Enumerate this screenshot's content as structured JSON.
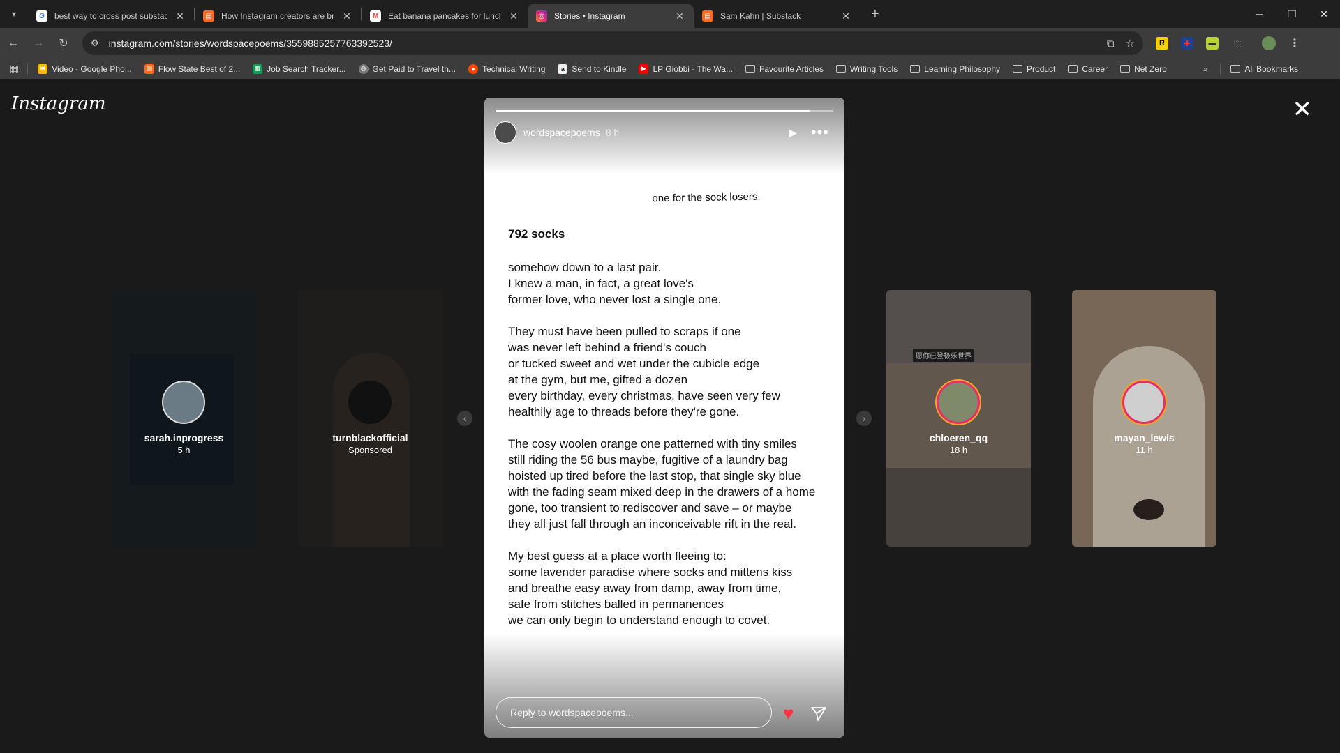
{
  "browser": {
    "tabs": [
      {
        "title": "best way to cross post substack",
        "icon": "google-icon",
        "color": "#4285f4",
        "active": false
      },
      {
        "title": "How Instagram creators are bri",
        "icon": "substack-icon",
        "color": "#ff6719",
        "active": false
      },
      {
        "title": "Eat banana pancakes for lunch",
        "icon": "gmail-icon",
        "color": "#ea4335",
        "active": false
      },
      {
        "title": "Stories • Instagram",
        "icon": "instagram-icon",
        "color": "#e1306c",
        "active": true
      },
      {
        "title": "Sam Kahn | Substack",
        "icon": "substack-icon",
        "color": "#ff6719",
        "active": false
      }
    ],
    "url": "instagram.com/stories/wordspacepoems/3559885257763392523/",
    "bookmarks": [
      {
        "label": "Video - Google Pho...",
        "type": "site",
        "color": "#fbbc04"
      },
      {
        "label": "Flow State Best of 2...",
        "type": "site",
        "color": "#ff6719"
      },
      {
        "label": "Job Search Tracker...",
        "type": "site",
        "color": "#0f9d58"
      },
      {
        "label": "Get Paid to Travel th...",
        "type": "site",
        "color": "#777777"
      },
      {
        "label": "Technical Writing",
        "type": "site",
        "color": "#ff4500"
      },
      {
        "label": "Send to Kindle",
        "type": "site",
        "color": "#232f3e"
      },
      {
        "label": "LP Giobbi - The Wa...",
        "type": "site",
        "color": "#ff0000"
      },
      {
        "label": "Favourite Articles",
        "type": "folder"
      },
      {
        "label": "Writing Tools",
        "type": "folder"
      },
      {
        "label": "Learning Philosophy",
        "type": "folder"
      },
      {
        "label": "Product",
        "type": "folder"
      },
      {
        "label": "Career",
        "type": "folder"
      },
      {
        "label": "Net Zero",
        "type": "folder"
      }
    ],
    "all_bookmarks": "All Bookmarks"
  },
  "instagram": {
    "logo": "Instagram",
    "story": {
      "username": "wordspacepoems",
      "time": "8 h",
      "progress": 0.93,
      "subtitle": "one for the sock losers.",
      "poem_title": "792 socks",
      "stanzas": [
        [
          "somehow down to a last pair.",
          "I knew a man, in fact, a great love's",
          "former love, who never lost a single one."
        ],
        [
          "They must have been pulled to scraps if one",
          "was never left behind a friend's couch",
          "or tucked sweet and wet under the cubicle edge",
          "at the gym, but me, gifted a dozen",
          "every birthday, every christmas, have seen very few",
          "healthily age to threads before they're gone."
        ],
        [
          "The cosy woolen orange one patterned with tiny smiles",
          "still riding the 56 bus maybe, fugitive of a laundry bag",
          "hoisted up tired before the last stop, that single sky blue",
          "with the fading seam mixed deep in the drawers of a home",
          "gone, too transient to rediscover and save – or maybe",
          "they all just fall through an inconceivable rift in the real."
        ],
        [
          "My best guess at a place worth fleeing to:",
          "some lavender paradise where socks and mittens kiss",
          "and breathe easy away from damp, away from time,",
          "safe from stitches balled in permanences",
          "we can only begin to understand enough to covet."
        ]
      ],
      "reply_placeholder": "Reply to wordspacepoems..."
    },
    "side_stories": [
      {
        "name": "sarah.inprogress",
        "meta": "5 h"
      },
      {
        "name": "turnblackofficial",
        "meta": "Sponsored"
      },
      {
        "name": "chloeren_qq",
        "meta": "18 h",
        "overlay_text": "愿你已登极乐世界"
      },
      {
        "name": "mayan_lewis",
        "meta": "11 h"
      }
    ]
  }
}
